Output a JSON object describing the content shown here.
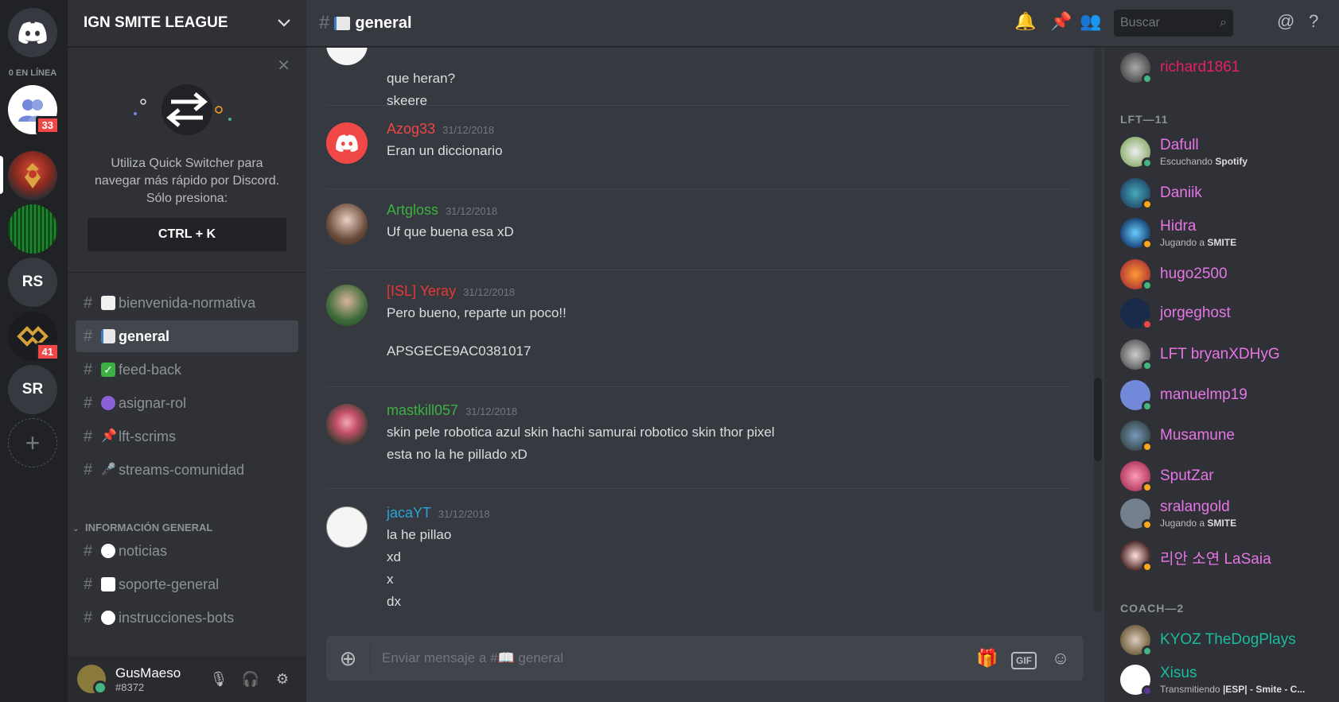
{
  "colors": {
    "accent": "#7289da",
    "online": "#43b581",
    "idle": "#faa61a",
    "dnd": "#f04747"
  },
  "guilds": {
    "online_label": "0 EN LÍNEA",
    "badge_friends": "33",
    "badge_guild": "41",
    "rs": "RS",
    "sr": "SR"
  },
  "sidebar": {
    "guild_name": "IGN SMITE LEAGUE",
    "quick_switcher": {
      "line1": "Utiliza Quick Switcher para",
      "line2": "navegar más rápido por Discord.",
      "line3": "Sólo presiona:",
      "key": "CTRL + K"
    },
    "channels": [
      {
        "name": "bienvenida-normativa",
        "icon": "page-icon",
        "color": "#f0f0f0"
      },
      {
        "name": "general",
        "icon": "book-icon",
        "color": "#e8e8e8"
      },
      {
        "name": "feed-back",
        "icon": "check-icon",
        "color": "#3cb043"
      },
      {
        "name": "asignar-rol",
        "icon": "crystal-ball-icon",
        "color": "#8b5fd6"
      },
      {
        "name": "lft-scrims",
        "icon": "pushpin-icon",
        "color": "#e53935"
      },
      {
        "name": "streams-comunidad",
        "icon": "microphone-icon",
        "color": "#cfcfcf"
      }
    ],
    "category_info": "INFORMACIÓN GENERAL",
    "info_channels": [
      {
        "name": "noticias",
        "icon": "clock-icon",
        "color": "#ffffff"
      },
      {
        "name": "soporte-general",
        "icon": "speech-icon",
        "color": "#ffffff"
      },
      {
        "name": "instrucciones-bots",
        "icon": "robot-icon",
        "color": "#ffffff"
      }
    ],
    "user": {
      "name": "GusMaeso",
      "tag": "#8372"
    }
  },
  "chat": {
    "channel": "general",
    "search_placeholder": "Buscar",
    "composer_placeholder": "Enviar mensaje a #📖 general",
    "messages": [
      {
        "author": "",
        "time": "",
        "lines": [
          "que heran?",
          "skeere"
        ],
        "color": "#ffffff"
      },
      {
        "author": "Azog33",
        "time": "31/12/2018",
        "lines": [
          "Eran un diccionario"
        ],
        "color": "#f04747"
      },
      {
        "author": "Artgloss",
        "time": "31/12/2018",
        "lines": [
          "Uf que buena esa xD"
        ],
        "color": "#3cb043"
      },
      {
        "author": "[ISL] Yeray",
        "time": "31/12/2018",
        "lines": [
          "Pero bueno, reparte un poco!!",
          "APSGECE9AC0381017"
        ],
        "color": "#e53935"
      },
      {
        "author": "mastkill057",
        "time": "31/12/2018",
        "lines": [
          "skin pele robotica azul skin hachi samurai robotico skin thor pixel",
          "esta no la he pillado xD"
        ],
        "color": "#3cb043"
      },
      {
        "author": "jacaYT",
        "time": "31/12/2018",
        "lines": [
          "la he pillao",
          "xd",
          "x",
          "dx"
        ],
        "color": "#2aa3d8"
      }
    ]
  },
  "members": {
    "top": {
      "name": "richard1861",
      "color": "#e91e63",
      "status": "online"
    },
    "lft_label": "LFT—11",
    "lft": [
      {
        "name": "Dafull",
        "color": "#e675e6",
        "status": "online",
        "activity_prefix": "Escuchando",
        "activity": "Spotify"
      },
      {
        "name": "Daniik",
        "color": "#e675e6",
        "status": "idle"
      },
      {
        "name": "Hidra",
        "color": "#e675e6",
        "status": "idle",
        "activity_prefix": "Jugando a",
        "activity": "SMITE"
      },
      {
        "name": "hugo2500",
        "color": "#e675e6",
        "status": "online"
      },
      {
        "name": "jorgeghost",
        "color": "#e675e6",
        "status": "dnd"
      },
      {
        "name": "LFT bryanXDHyG",
        "color": "#e675e6",
        "status": "online"
      },
      {
        "name": "manuelmp19",
        "color": "#e675e6",
        "status": "online"
      },
      {
        "name": "Musamune",
        "color": "#e675e6",
        "status": "idle"
      },
      {
        "name": "SputZar",
        "color": "#e675e6",
        "status": "idle"
      },
      {
        "name": "sralangold",
        "color": "#e675e6",
        "status": "idle",
        "activity_prefix": "Jugando a",
        "activity": "SMITE"
      },
      {
        "name": "리안 소연 LaSaia",
        "color": "#e675e6",
        "status": "idle"
      }
    ],
    "coach_label": "COACH—2",
    "coach": [
      {
        "name": "KYOZ TheDogPlays",
        "color": "#1abc9c",
        "status": "online"
      },
      {
        "name": "Xisus",
        "color": "#1abc9c",
        "status": "online",
        "activity_prefix": "Transmitiendo",
        "activity": "|ESP| - Smite - C..."
      }
    ]
  }
}
